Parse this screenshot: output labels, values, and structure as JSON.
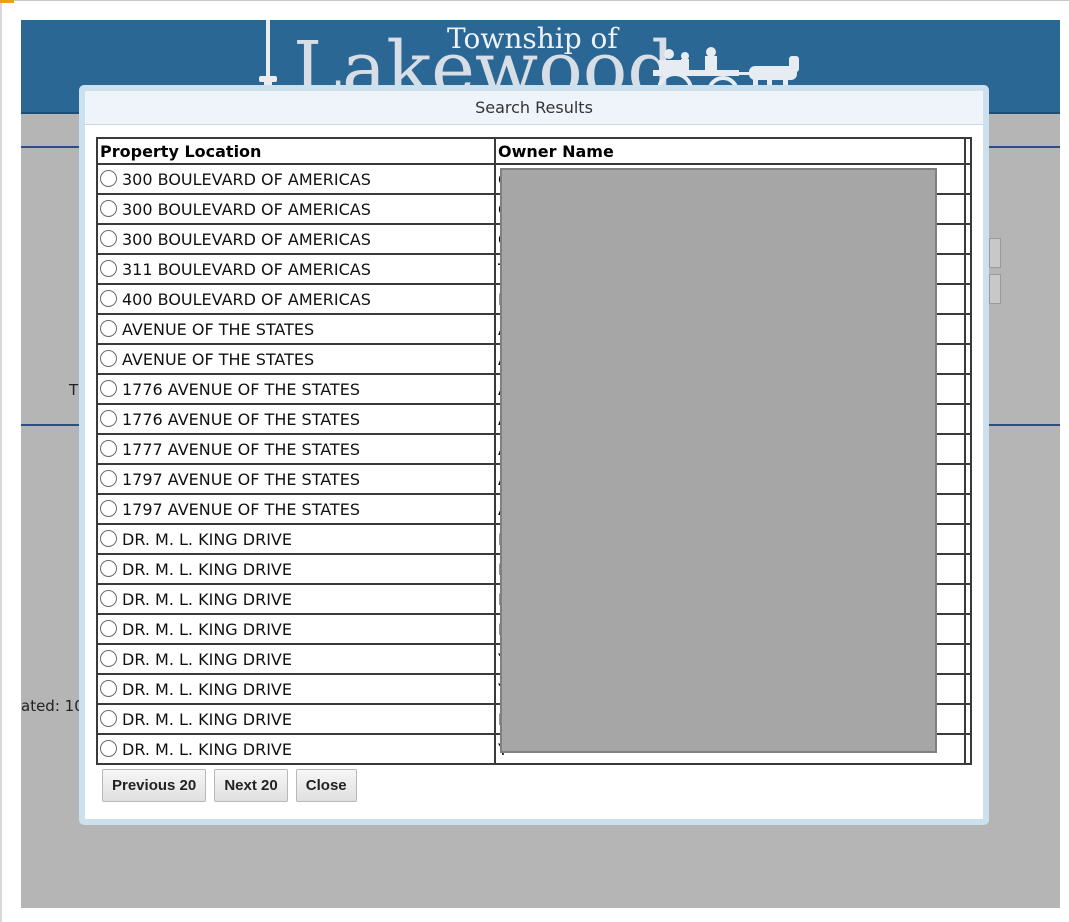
{
  "header": {
    "township_label": "Township of",
    "town_name": "Lakewood"
  },
  "background": {
    "fragment_t": "T",
    "fragment_updated": "ated: 10"
  },
  "dialog": {
    "title": "Search Results",
    "columns": [
      "Property Location",
      "Owner Name"
    ],
    "rows": [
      {
        "location": "300 BOULEVARD OF AMERICAS",
        "owner_initial": "C"
      },
      {
        "location": "300 BOULEVARD OF AMERICAS",
        "owner_initial": "C"
      },
      {
        "location": "300 BOULEVARD OF AMERICAS",
        "owner_initial": "C"
      },
      {
        "location": "311 BOULEVARD OF AMERICAS",
        "owner_initial": "T"
      },
      {
        "location": "400 BOULEVARD OF AMERICAS",
        "owner_initial": "F"
      },
      {
        "location": "AVENUE OF THE STATES",
        "owner_initial": "A"
      },
      {
        "location": "AVENUE OF THE STATES",
        "owner_initial": "A"
      },
      {
        "location": "1776 AVENUE OF THE STATES",
        "owner_initial": "A"
      },
      {
        "location": "1776 AVENUE OF THE STATES",
        "owner_initial": "A"
      },
      {
        "location": "1777 AVENUE OF THE STATES",
        "owner_initial": "A"
      },
      {
        "location": "1797 AVENUE OF THE STATES",
        "owner_initial": "A"
      },
      {
        "location": "1797 AVENUE OF THE STATES",
        "owner_initial": "A"
      },
      {
        "location": "DR. M. L. KING DRIVE",
        "owner_initial": "M"
      },
      {
        "location": "DR. M. L. KING DRIVE",
        "owner_initial": "M"
      },
      {
        "location": "DR. M. L. KING DRIVE",
        "owner_initial": "M"
      },
      {
        "location": "DR. M. L. KING DRIVE",
        "owner_initial": "M"
      },
      {
        "location": "DR. M. L. KING DRIVE",
        "owner_initial": "Y"
      },
      {
        "location": "DR. M. L. KING DRIVE",
        "owner_initial": "Y"
      },
      {
        "location": "DR. M. L. KING DRIVE",
        "owner_initial": "M"
      },
      {
        "location": "DR. M. L. KING DRIVE",
        "owner_initial": "Y"
      }
    ],
    "buttons": {
      "previous": "Previous 20",
      "next": "Next 20",
      "close": "Close"
    }
  },
  "colors": {
    "header_blue": "#2a6795",
    "overlay_gray": "#b5b5b5",
    "dialog_border": "#cde0ee",
    "redaction_gray": "#a6a6a6"
  }
}
